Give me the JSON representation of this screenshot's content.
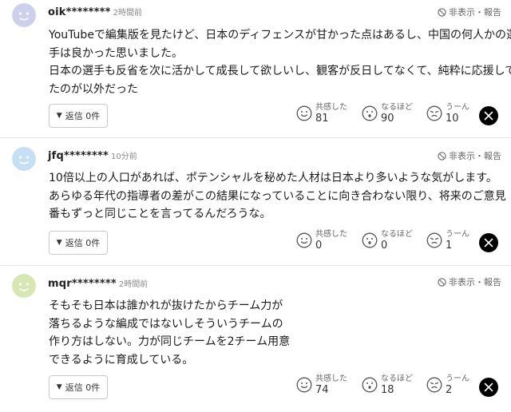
{
  "labels": {
    "hide_report": "非表示・報告",
    "reaction_empathy": "共感した",
    "reaction_indeed": "なるほど",
    "reaction_hmm": "うーん"
  },
  "comments": [
    {
      "username": "oik********",
      "time": "2時間前",
      "avatar_color": "#ccd0ec",
      "text": "YouTubeで編集版を見たけど、日本のディフェンスが甘かった点はあるし、中国の何人かの選\n手は良かった思いました。\n日本の選手も反省を次に活かして成長して欲しいし、観客が反日してなくて、純粋に応援して\nたのが以外だった",
      "reply_label": "返信 0件",
      "counts": {
        "empathy": "81",
        "indeed": "90",
        "hmm": "10"
      }
    },
    {
      "username": "jfq********",
      "time": "10分前",
      "avatar_color": "#c6e0f3",
      "text": "10倍以上の人口があれば、ポテンシャルを秘めた人材は日本より多いような気がします。\nあらゆる年代の指導者の差がこの結果になっていることに向き合わない限り、将来のご意見\n番もずっと同じことを言ってるんだろうな。",
      "reply_label": "返信 0件",
      "counts": {
        "empathy": "0",
        "indeed": "0",
        "hmm": "1"
      }
    },
    {
      "username": "mqr********",
      "time": "2時間前",
      "avatar_color": "#d6e7b3",
      "text": "そもそも日本は誰かれが抜けたからチーム力が\n落ちるような編成ではないしそういうチームの\n作り方はしない。力が同じチームを2チーム用意\nできるように育成している。",
      "reply_label": "返信 0件",
      "counts": {
        "empathy": "74",
        "indeed": "18",
        "hmm": "2"
      }
    }
  ]
}
